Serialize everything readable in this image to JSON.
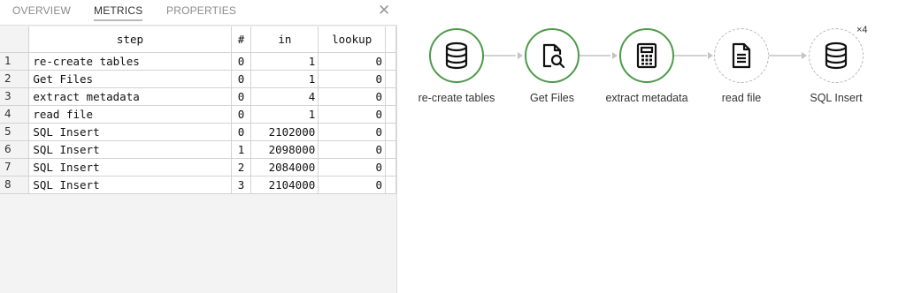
{
  "tabs": [
    {
      "label": "OVERVIEW",
      "active": false
    },
    {
      "label": "METRICS",
      "active": true
    },
    {
      "label": "PROPERTIES",
      "active": false
    }
  ],
  "close_symbol": "✕",
  "table": {
    "columns": [
      "step",
      "#",
      "in",
      "lookup"
    ],
    "rows": [
      {
        "num": "1",
        "step": "re-create tables",
        "copy": "0",
        "in": "1",
        "lookup": "0"
      },
      {
        "num": "2",
        "step": "Get Files",
        "copy": "0",
        "in": "1",
        "lookup": "0"
      },
      {
        "num": "3",
        "step": "extract metadata",
        "copy": "0",
        "in": "4",
        "lookup": "0"
      },
      {
        "num": "4",
        "step": "read file",
        "copy": "0",
        "in": "1",
        "lookup": "0"
      },
      {
        "num": "5",
        "step": "SQL Insert",
        "copy": "0",
        "in": "2102000",
        "lookup": "0"
      },
      {
        "num": "6",
        "step": "SQL Insert",
        "copy": "1",
        "in": "2098000",
        "lookup": "0"
      },
      {
        "num": "7",
        "step": "SQL Insert",
        "copy": "2",
        "in": "2084000",
        "lookup": "0"
      },
      {
        "num": "8",
        "step": "SQL Insert",
        "copy": "3",
        "in": "2104000",
        "lookup": "0"
      }
    ]
  },
  "pipeline": {
    "nodes": [
      {
        "label": "re-create tables",
        "icon": "database-icon",
        "style": "solid"
      },
      {
        "label": "Get Files",
        "icon": "file-search-icon",
        "style": "solid"
      },
      {
        "label": "extract metadata",
        "icon": "calculator-icon",
        "style": "solid"
      },
      {
        "label": "read file",
        "icon": "document-icon",
        "style": "dashed"
      },
      {
        "label": "SQL Insert",
        "icon": "database-icon",
        "style": "dashed"
      }
    ],
    "badge": "×4"
  },
  "colors": {
    "active_node_border": "#4d9a4a",
    "inactive_node_border": "#b8b8b8",
    "connector": "#d2d2d2",
    "panel_bg": "#f3f3f3"
  }
}
